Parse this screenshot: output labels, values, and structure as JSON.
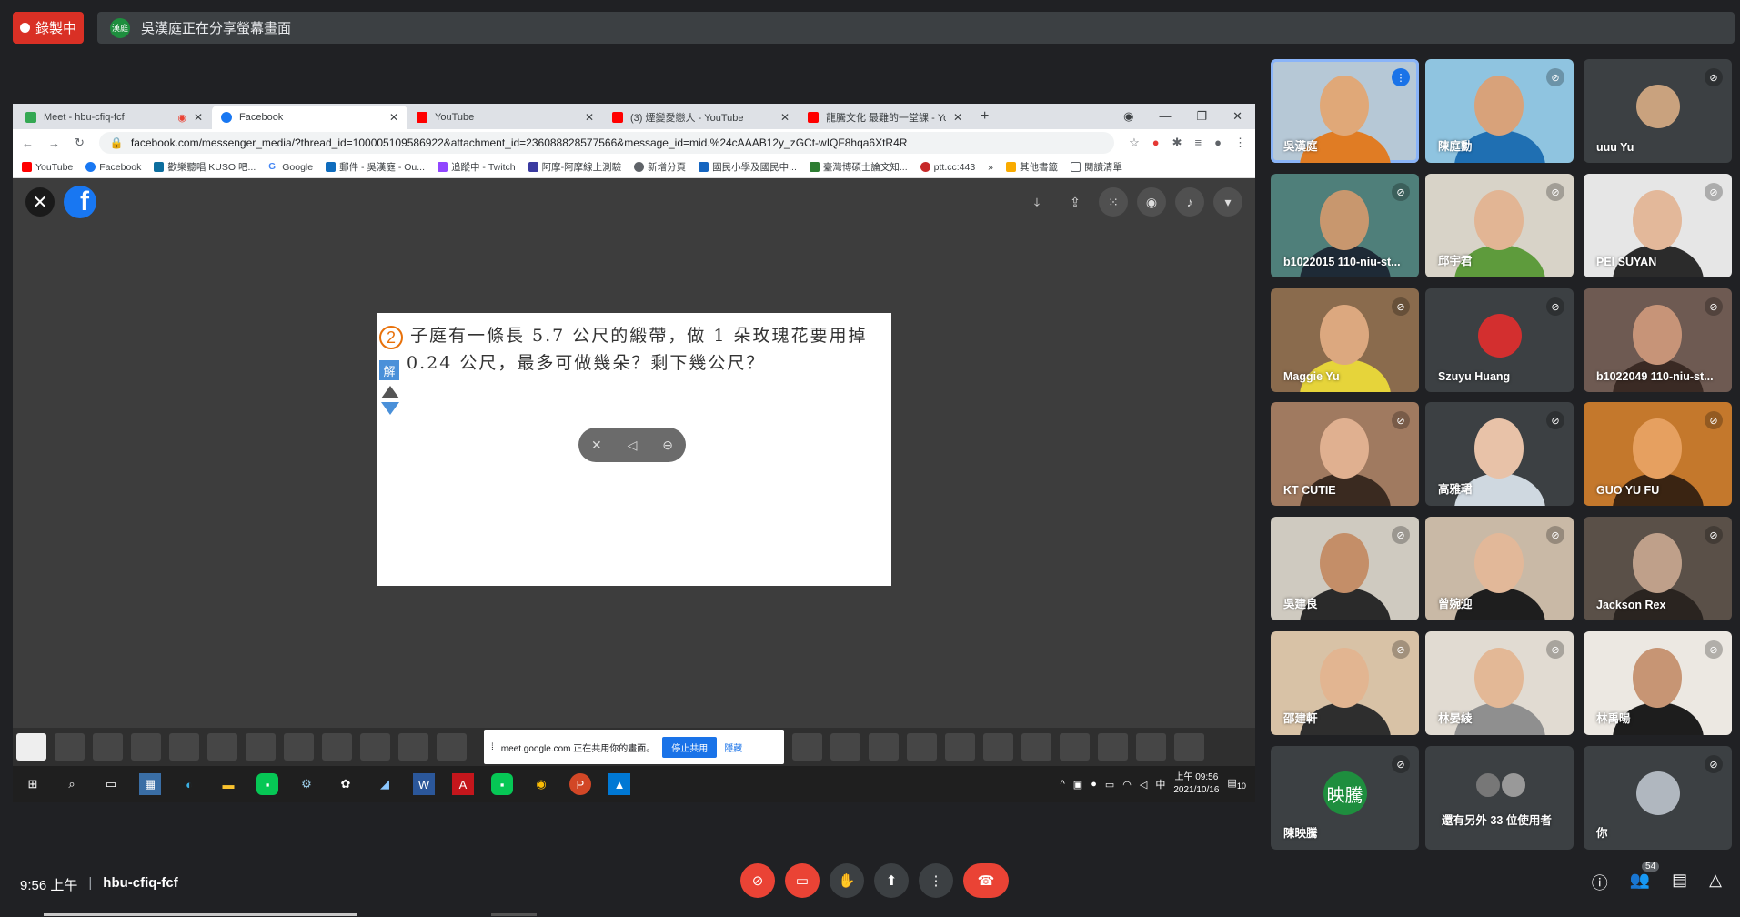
{
  "recording": {
    "label": "錄製中"
  },
  "presenting": {
    "avatar": "漢庭",
    "text": "吳漢庭正在分享螢幕畫面"
  },
  "browser": {
    "tabs": [
      {
        "title": "Meet - hbu-cfiq-fcf",
        "color": "#34a853"
      },
      {
        "title": "Facebook",
        "color": "#1877f2"
      },
      {
        "title": "YouTube",
        "color": "#ff0000"
      },
      {
        "title": "(3) 煙變愛戀人 - YouTube",
        "color": "#ff0000"
      },
      {
        "title": "龍騰文化 最難的一堂課 - YouTube",
        "color": "#ff0000"
      }
    ],
    "url": "facebook.com/messenger_media/?thread_id=100005109586922&attachment_id=236088828577566&message_id=mid.%24cAAAB12y_zGCt-wIQF8hqa6XtR4R",
    "bookmarks": [
      "YouTube",
      "Facebook",
      "歡樂聽唱 KUSO 吧...",
      "Google",
      "郵件 - 吳漢庭 - Ou...",
      "追蹤中 - Twitch",
      "阿摩-阿摩線上測驗",
      "新增分頁",
      "國民小學及國民中...",
      "臺灣博碩士論文知...",
      "ptt.cc:443",
      "其他書籤",
      "閱讀清單"
    ]
  },
  "slide": {
    "number": "2",
    "line1": "子庭有一條長 5.7 公尺的緞帶，做 1 朵玫瑰花要用掉",
    "line2": "0.24 公尺，最多可做幾朵？剩下幾公尺？",
    "solve": "解"
  },
  "share_notice": {
    "text": "meet.google.com 正在共用你的畫面。",
    "stop": "停止共用",
    "hide": "隱藏"
  },
  "taskbar": {
    "time": "上午 09:56",
    "date": "2021/10/16",
    "ime": "中",
    "notif": "10"
  },
  "participants": [
    {
      "name": "吳漢庭",
      "bg": "#b6c8d6",
      "face": "#e0a878",
      "shirt": "#e07c24"
    },
    {
      "name": "陳庭勳",
      "bg": "#8fc4e0",
      "face": "#d8a27a",
      "shirt": "#1f6fb2"
    },
    {
      "name": "uuu Yu",
      "avatar_color": "#c9a27e"
    },
    {
      "name": "b1022015 110-niu-st...",
      "bg": "#4f7f7a",
      "face": "#c8976e",
      "shirt": "#1e2a36"
    },
    {
      "name": "邱宇君",
      "bg": "#d8d3c8",
      "face": "#e2b594",
      "shirt": "#5e9b3c"
    },
    {
      "name": "PEI SUYAN",
      "bg": "#e6e6e6",
      "face": "#e3b89a",
      "shirt": "#2b2b2b"
    },
    {
      "name": "Maggie Yu",
      "bg": "#8a6b4d",
      "face": "#dca87f",
      "shirt": "#e6d43a"
    },
    {
      "name": "Szuyu Huang",
      "avatar_color": "#d32f2f"
    },
    {
      "name": "b1022049 110-niu-st...",
      "bg": "#6e5a52",
      "face": "#c79478",
      "shirt": "#3a2a24"
    },
    {
      "name": "KT CUTIE",
      "bg": "#a07a60",
      "face": "#e0b090",
      "shirt": "#3a2a20"
    },
    {
      "name": "高雅珺",
      "bg": "#3c4043",
      "face": "#e8c2a8",
      "shirt": "#cfd8e0"
    },
    {
      "name": "GUO YU FU",
      "bg": "#c4782c",
      "face": "#e6a060",
      "shirt": "#3a2412"
    },
    {
      "name": "吳建良",
      "bg": "#cfcac0",
      "face": "#c48e68",
      "shirt": "#2a2a2a"
    },
    {
      "name": "曾婉迎",
      "bg": "#c9b9a6",
      "face": "#e2b899",
      "shirt": "#1e1e1e"
    },
    {
      "name": "Jackson Rex",
      "bg": "#5a5048",
      "face": "#bfa08a",
      "shirt": "#2a2420"
    },
    {
      "name": "邵建軒",
      "bg": "#d8c2a6",
      "face": "#e2b591",
      "shirt": "#2e2e2e"
    },
    {
      "name": "林晏綾",
      "bg": "#e1dbd2",
      "face": "#e3b896",
      "shirt": "#8f8f8f"
    },
    {
      "name": "林禹暘",
      "bg": "#ece8e2",
      "face": "#c79574",
      "shirt": "#1d1d1d"
    },
    {
      "name": "陳映騰",
      "avatar": "映騰",
      "avatar_color": "#1e8e3e"
    },
    {
      "name": "還有另外 33 位使用者"
    },
    {
      "name": "你",
      "avatar_color": "#b0b7bf"
    }
  ],
  "meeting": {
    "time": "9:56 上午",
    "code": "hbu-cfiq-fcf",
    "people_count": "54"
  }
}
